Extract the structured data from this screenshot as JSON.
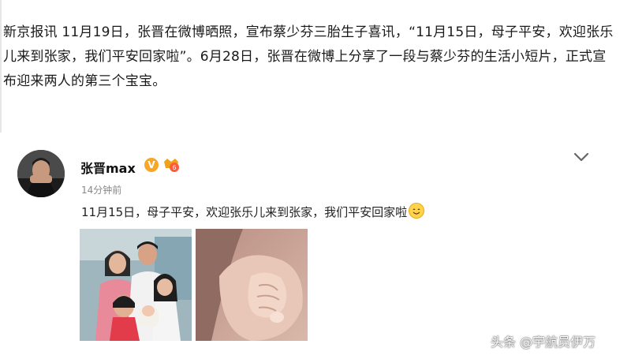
{
  "article": {
    "lines": [
      "新京报讯 11月19日，张晋在微博晒照，宣布蔡少芬三胎生子喜讯，“11月15日，母子平安，欢迎张乐",
      "儿来到张家，我们平安回家啦”。6月28日，张晋在微博上分享了一段与蔡少芬的生活小短片，正式宣",
      "布迎来两人的第三个宝宝。"
    ]
  },
  "post": {
    "username": "张晋max",
    "verified_badge": "V",
    "timestamp": "14分钟前",
    "text": "11月15日，母子平安，欢迎张乐儿来到张家，我们平安回家啦",
    "icons": {
      "avatar": "avatar-photo",
      "verified": "verified-v-icon",
      "level": "level-badge-icon",
      "menu": "chevron-down-icon",
      "emoji": "smile-emoji-icon"
    },
    "images": [
      "family-photo",
      "baby-hand-photo"
    ]
  },
  "watermark": "头条 @宇航员伊万"
}
